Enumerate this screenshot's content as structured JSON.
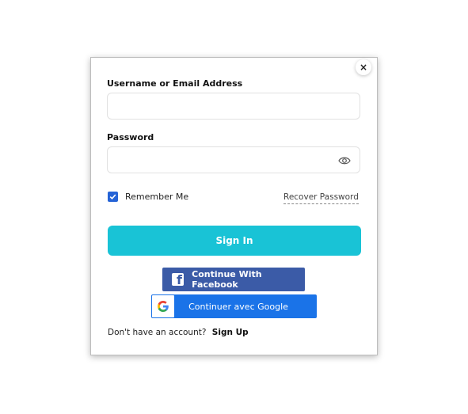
{
  "form": {
    "close_glyph": "×",
    "username_label": "Username or Email Address",
    "username_value": "",
    "password_label": "Password",
    "password_value": "",
    "remember_label": "Remember Me",
    "remember_checked": true,
    "recover_label": "Recover Password",
    "signin_label": "Sign In",
    "facebook_label": "Continue With Facebook",
    "google_label": "Continuer avec Google",
    "no_account_text": "Don't have an account?",
    "signup_label": "Sign Up"
  },
  "colors": {
    "signin_bg": "#19c3d6",
    "facebook_bg": "#3b5ba7",
    "google_bg": "#1a73e8",
    "checkbox_bg": "#2563d6"
  },
  "icons": {
    "close": "close-icon",
    "eye": "eye-icon",
    "check": "check-icon",
    "facebook": "facebook-icon",
    "google": "google-icon"
  }
}
